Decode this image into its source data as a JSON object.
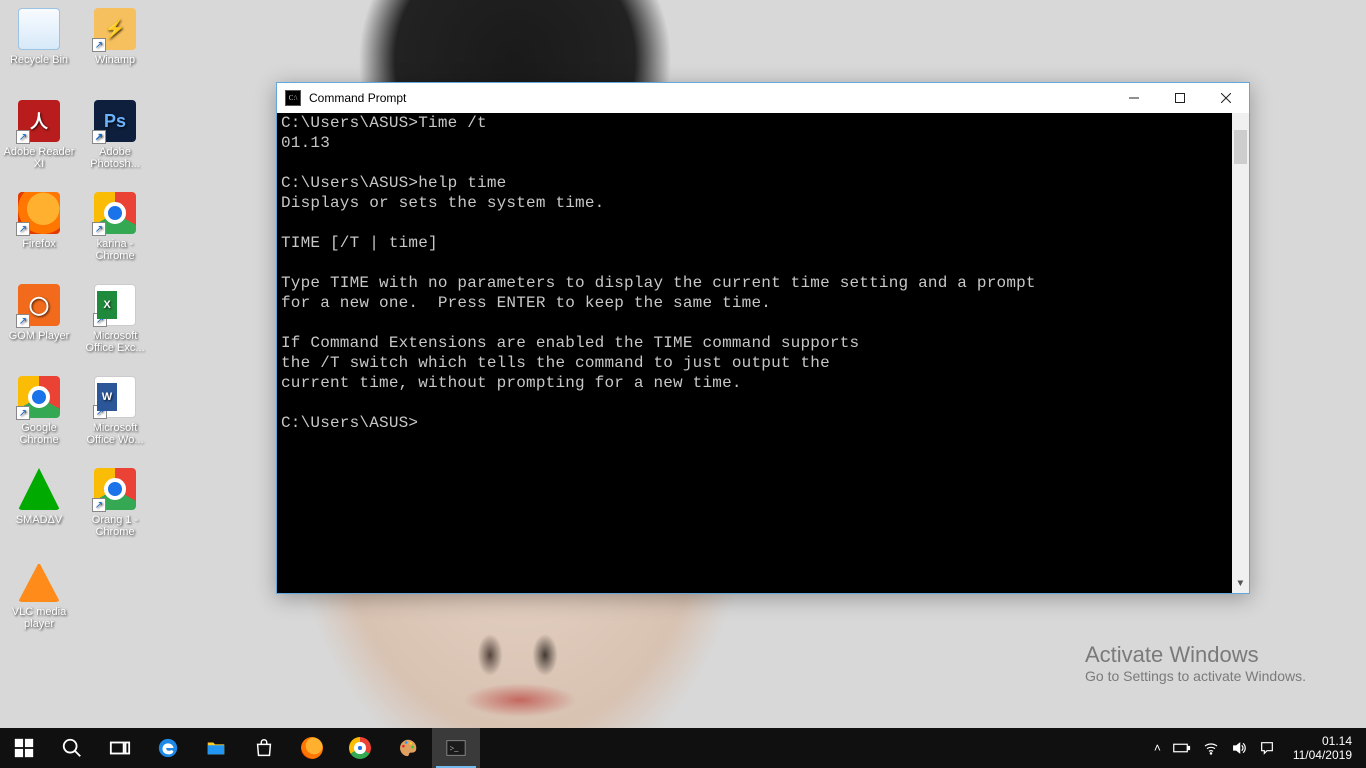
{
  "desktop_icons": {
    "recycle": "Recycle Bin",
    "winamp": "Winamp",
    "adobe_reader": "Adobe Reader XI",
    "photoshop": "Adobe Photosh...",
    "firefox": "Firefox",
    "karina_chrome": "karina - Chrome",
    "gom": "GOM Player",
    "excel": "Microsoft Office Exc...",
    "google_chrome": "Google Chrome",
    "word": "Microsoft Office Wo...",
    "smadav": "SMADΔV",
    "orang1": "Orang 1 - Chrome",
    "vlc": "VLC media player"
  },
  "cmd": {
    "title": "Command Prompt",
    "lines": "C:\\Users\\ASUS>Time /t\n01.13\n\nC:\\Users\\ASUS>help time\nDisplays or sets the system time.\n\nTIME [/T | time]\n\nType TIME with no parameters to display the current time setting and a prompt\nfor a new one.  Press ENTER to keep the same time.\n\nIf Command Extensions are enabled the TIME command supports\nthe /T switch which tells the command to just output the\ncurrent time, without prompting for a new time.\n\nC:\\Users\\ASUS>"
  },
  "watermark": {
    "line1": "Activate Windows",
    "line2": "Go to Settings to activate Windows."
  },
  "taskbar": {
    "time": "01.14",
    "date": "11/04/2019"
  }
}
